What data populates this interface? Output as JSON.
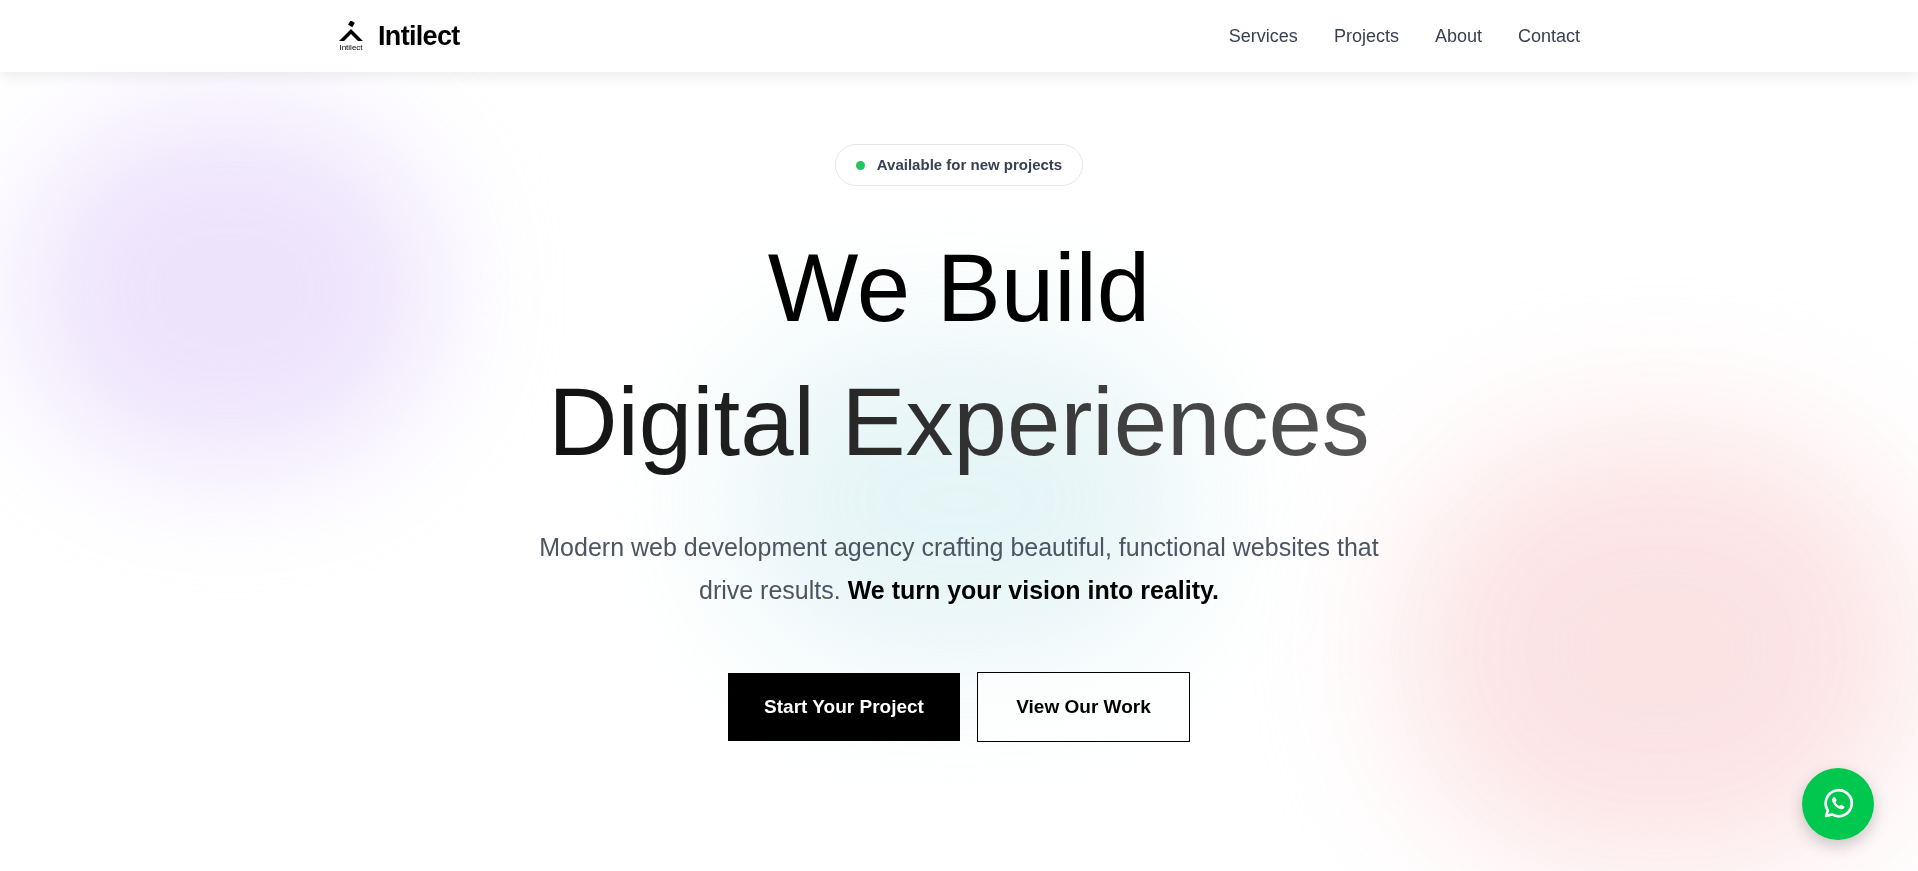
{
  "header": {
    "brand": "Intilect",
    "logo_caption": "Intilect",
    "nav": [
      {
        "label": "Services"
      },
      {
        "label": "Projects"
      },
      {
        "label": "About"
      },
      {
        "label": "Contact"
      }
    ]
  },
  "hero": {
    "badge": {
      "label": "Available for new projects",
      "color": "#22c55e"
    },
    "title_lines": [
      "We Build",
      "Digital Experiences"
    ],
    "description": "Modern web development agency crafting beautiful, functional websites that drive results. **We turn your vision into reality.**",
    "buttons": [
      {
        "label": "Start Your Project",
        "kind": "primary"
      },
      {
        "label": "View Our Work",
        "kind": "outline"
      }
    ]
  },
  "chat_button": {
    "kind": "whatsapp"
  }
}
